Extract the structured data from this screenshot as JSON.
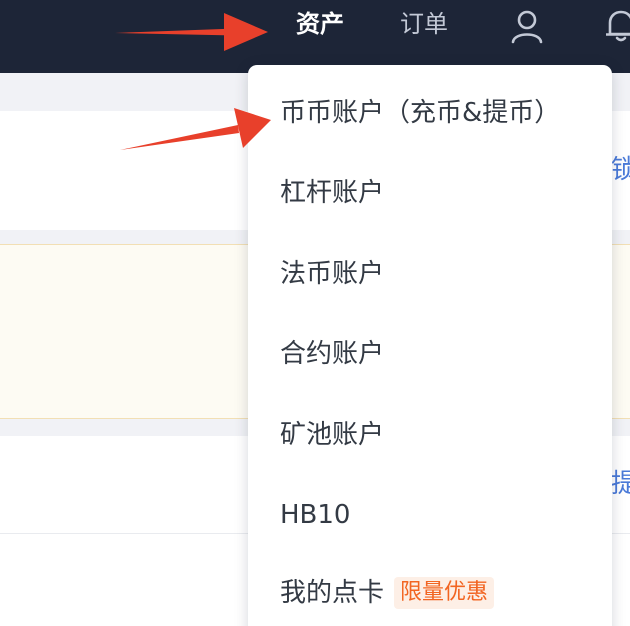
{
  "colors": {
    "nav_background": "#1d2537",
    "nav_active_text": "#ffffff",
    "nav_text": "#c3c9d6",
    "link_blue": "#4a7ad8",
    "badge_orange": "#f26522",
    "annotation_red": "#e8402b"
  },
  "header": {
    "nav_items": [
      {
        "label": "资产",
        "active": true
      },
      {
        "label": "订单",
        "active": false
      }
    ],
    "icons": [
      "user-icon",
      "bell-icon"
    ]
  },
  "dropdown": {
    "items": [
      {
        "label": "币币账户（充币&提币）"
      },
      {
        "label": "杠杆账户"
      },
      {
        "label": "法币账户"
      },
      {
        "label": "合约账户"
      },
      {
        "label": "矿池账户"
      },
      {
        "label": "HB10"
      },
      {
        "label": "我的点卡",
        "badge": "限量优惠"
      }
    ]
  },
  "background_page": {
    "edge_links": [
      "锁",
      "提"
    ]
  }
}
